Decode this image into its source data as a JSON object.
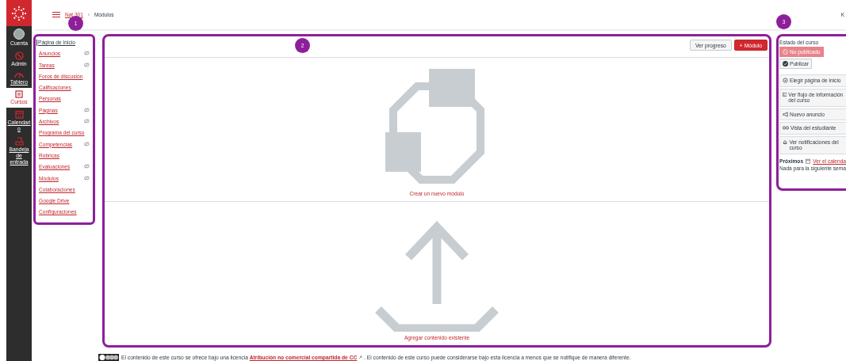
{
  "global_nav": [
    {
      "label": "Cuenta",
      "kind": "avatar",
      "selected": false,
      "underlined": false
    },
    {
      "label": "Admin",
      "kind": "admin",
      "selected": false,
      "underlined": false
    },
    {
      "label": "Tablero",
      "kind": "dashboard",
      "selected": false,
      "underlined": true
    },
    {
      "label": "Cursos",
      "kind": "courses",
      "selected": true,
      "underlined": false
    },
    {
      "label": "Calendario",
      "kind": "calendar",
      "selected": false,
      "underlined": true
    },
    {
      "label": "Bandeja de entrada",
      "kind": "inbox",
      "selected": false,
      "underlined": true
    }
  ],
  "breadcrumb_separator": "›",
  "breadcrumbs": [
    {
      "label": "Nat 301",
      "link": true
    },
    {
      "label": "Módulos",
      "link": false
    }
  ],
  "header_right": "K",
  "callouts": [
    "1",
    "2",
    "3"
  ],
  "course_nav": [
    {
      "label": "Página de Inicio",
      "selected": true,
      "hidden": false
    },
    {
      "label": "Anuncios",
      "selected": false,
      "hidden": true
    },
    {
      "label": "Tareas",
      "selected": false,
      "hidden": true
    },
    {
      "label": "Foros de discusión",
      "selected": false,
      "hidden": false
    },
    {
      "label": "Calificaciones",
      "selected": false,
      "hidden": false
    },
    {
      "label": "Personas",
      "selected": false,
      "hidden": false
    },
    {
      "label": "Páginas",
      "selected": false,
      "hidden": true
    },
    {
      "label": "Archivos",
      "selected": false,
      "hidden": true
    },
    {
      "label": "Programa del curso",
      "selected": false,
      "hidden": false
    },
    {
      "label": "Competencias",
      "selected": false,
      "hidden": true
    },
    {
      "label": "Rúbricas",
      "selected": false,
      "hidden": false
    },
    {
      "label": "Evaluaciones",
      "selected": false,
      "hidden": true
    },
    {
      "label": "Módulos",
      "selected": false,
      "hidden": true
    },
    {
      "label": "Colaboraciones",
      "selected": false,
      "hidden": false
    },
    {
      "label": "Google Drive",
      "selected": false,
      "hidden": false
    },
    {
      "label": "Configuraciones",
      "selected": false,
      "hidden": false
    }
  ],
  "toolbar": {
    "progress_button": "Ver progreso",
    "add_module_button": "+ Módulo"
  },
  "empty_state": {
    "create_link": "Crear un nuevo módulo",
    "add_link": "Agregar contenido existente"
  },
  "footer": {
    "before": "El contenido de este curso se ofrece bajo una licencia",
    "link": "Atribución no comercial compartida de CC",
    "after": ". El contenido de este curso puede considerarse bajo esta licencia a menos que se notifique de manera diferente."
  },
  "sidebar": {
    "status_title": "Estado del curso",
    "status_buttons": [
      {
        "label": "No publicado",
        "kind": "unpublished",
        "selected": true
      },
      {
        "label": "Publicar",
        "kind": "publish",
        "selected": false
      }
    ],
    "actions": [
      {
        "label": "Elegir página de inicio",
        "kind": "home"
      },
      {
        "label": "Ver flujo de información del curso",
        "kind": "stream"
      },
      {
        "label": "Nuevo anuncio",
        "kind": "announce"
      },
      {
        "label": "Vista del estudiante",
        "kind": "student"
      },
      {
        "label": "Ver notificaciones del curso",
        "kind": "bell"
      }
    ],
    "upcoming_title": "Próximos",
    "calendar_link": "Ver el calenda",
    "upcoming_empty": "Nada para la siguiente sema"
  }
}
